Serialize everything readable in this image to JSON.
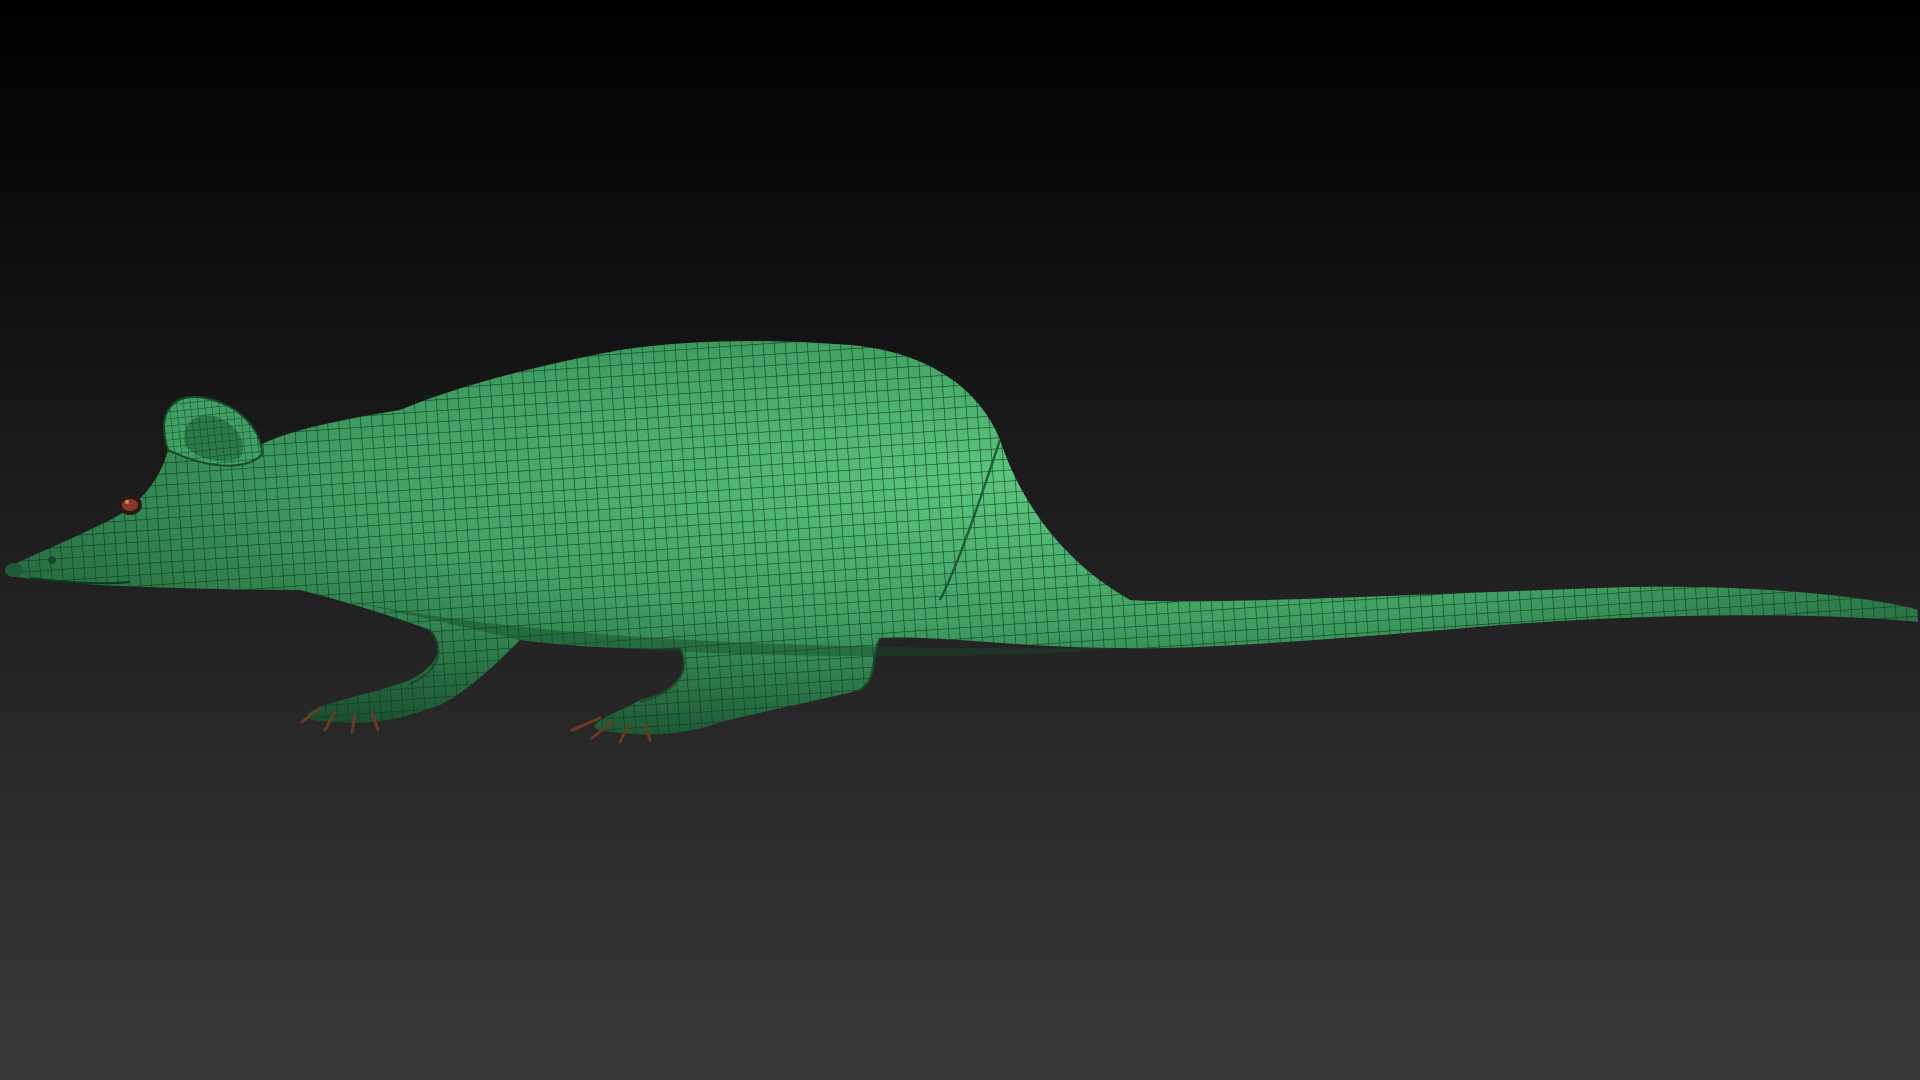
{
  "viewport": {
    "background_top_color": "#000000",
    "background_bottom_color": "#393939"
  },
  "model": {
    "subject": "rat",
    "base_color": "#3fa062",
    "highlight_color": "#5cc77f",
    "shadow_color": "#17492a",
    "wireframe_color": "#0f3a20",
    "eye_color": "#8a3a2a",
    "claw_color": "#6b3a22",
    "wireframe_visible": true
  }
}
